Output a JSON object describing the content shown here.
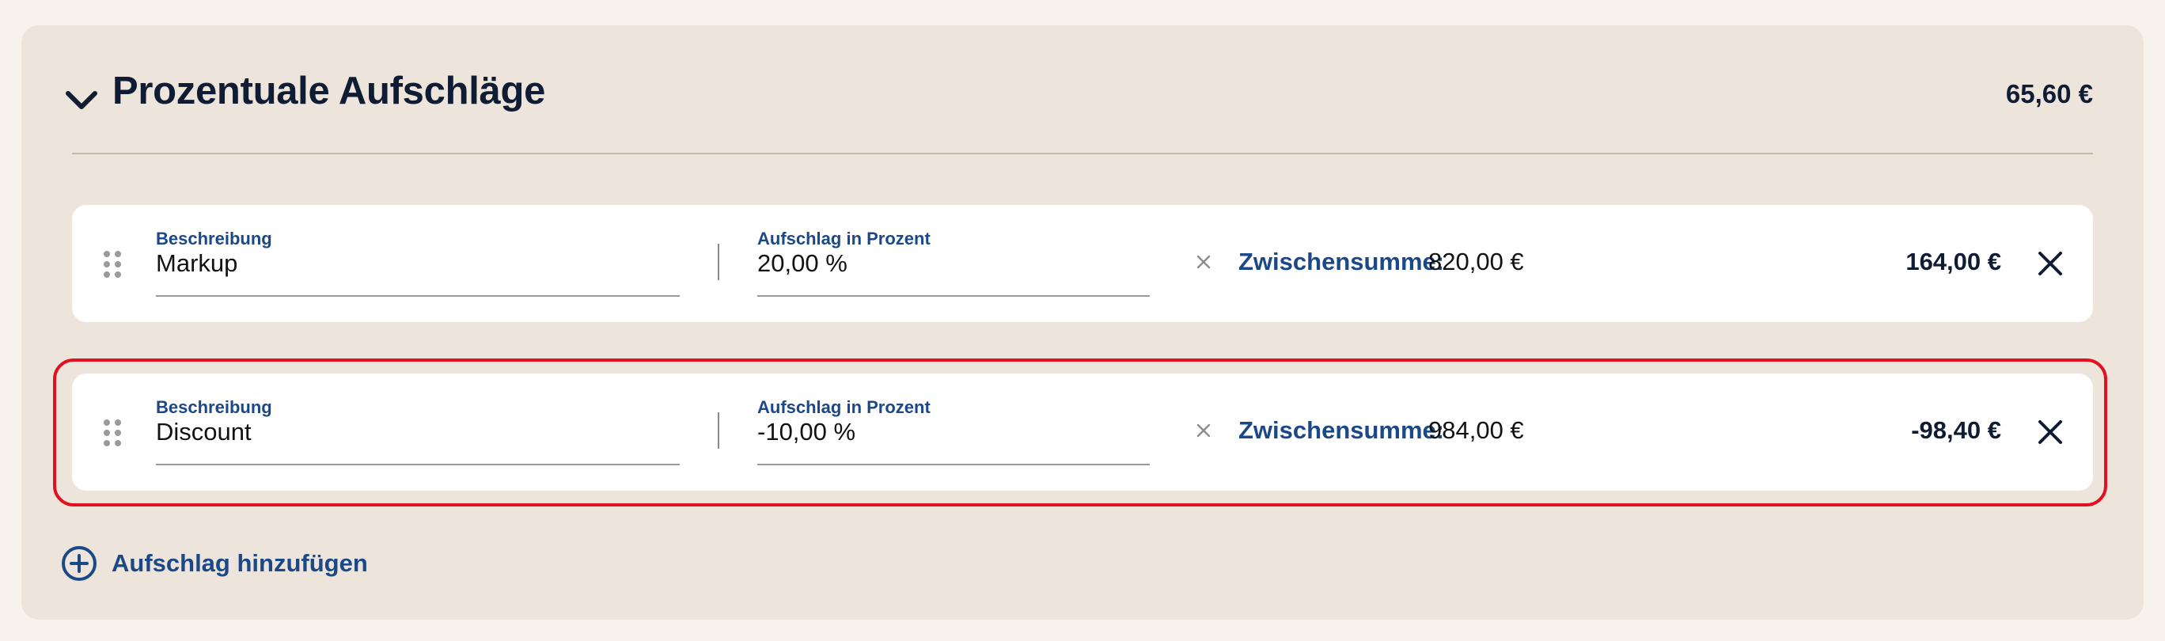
{
  "section": {
    "title": "Prozentuale Aufschläge",
    "total": "65,60 €"
  },
  "rows": [
    {
      "description_label": "Beschreibung",
      "description_value": "Markup",
      "percent_label": "Aufschlag in Prozent",
      "percent_value": "20,00 %",
      "subtotal_label": "Zwischensumme:",
      "subtotal_value": "820,00 €",
      "amount": "164,00 €"
    },
    {
      "description_label": "Beschreibung",
      "description_value": "Discount",
      "percent_label": "Aufschlag in Prozent",
      "percent_value": "-10,00 %",
      "subtotal_label": "Zwischensumme:",
      "subtotal_value": "984,00 €",
      "amount": "-98,40 €",
      "highlighted": true
    }
  ],
  "add_button": {
    "label": "Aufschlag hinzufügen"
  },
  "icons": {
    "collapse": "chevron-down-icon",
    "drag": "drag-handle-icon",
    "multiply": "times-icon",
    "remove": "close-icon",
    "add": "plus-circle-icon"
  },
  "colors": {
    "accent": "#1b4886",
    "highlight": "#e3101f",
    "panel": "#ede5db",
    "text": "#0f1c33"
  }
}
